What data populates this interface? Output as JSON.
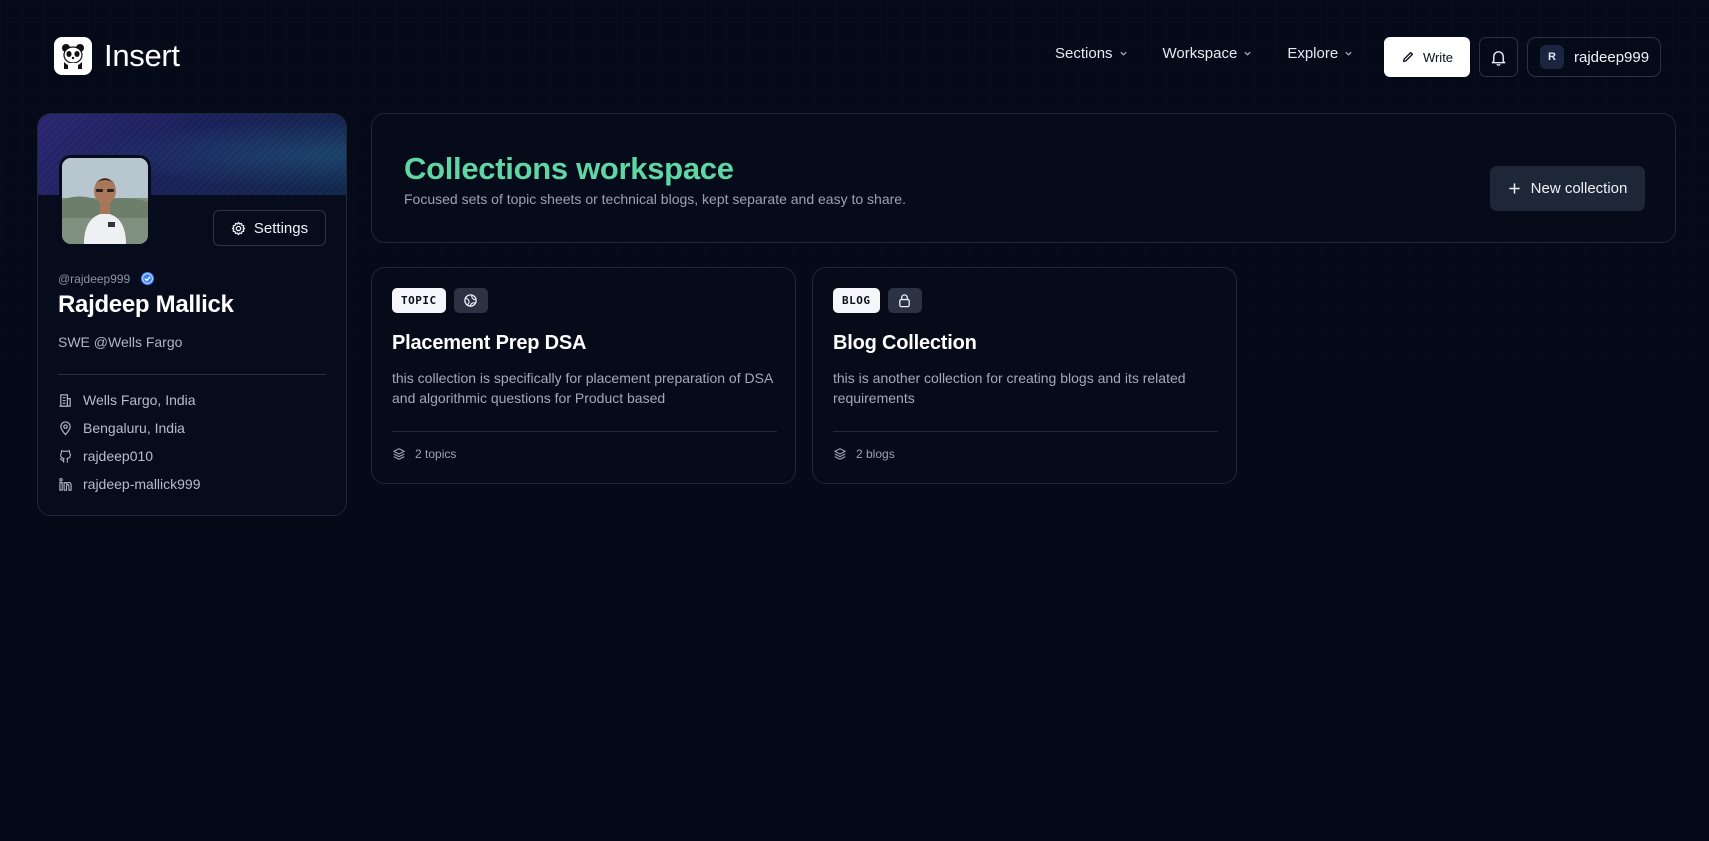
{
  "header": {
    "brand": "Insert",
    "nav": [
      {
        "label": "Sections"
      },
      {
        "label": "Workspace"
      },
      {
        "label": "Explore"
      }
    ],
    "write_label": "Write",
    "user": {
      "initial": "R",
      "username": "rajdeep999"
    }
  },
  "profile": {
    "settings_label": "Settings",
    "handle": "@rajdeep999",
    "name": "Rajdeep Mallick",
    "bio": "SWE @Wells Fargo",
    "details": [
      {
        "icon": "building-icon",
        "text": "Wells Fargo, India"
      },
      {
        "icon": "location-pin-icon",
        "text": "Bengaluru, India"
      },
      {
        "icon": "github-icon",
        "text": "rajdeep010"
      },
      {
        "icon": "linkedin-icon",
        "text": "rajdeep-mallick999"
      }
    ]
  },
  "workspace": {
    "title": "Collections workspace",
    "subtitle": "Focused sets of topic sheets or technical blogs, kept separate and easy to share.",
    "new_collection_label": "New collection"
  },
  "collections": [
    {
      "tag": "TOPIC",
      "visibility_icon": "globe-icon",
      "title": "Placement Prep DSA",
      "description": "this collection is specifically for placement preparation of DSA and algorithmic questions for Product based",
      "count_label": "2 topics"
    },
    {
      "tag": "BLOG",
      "visibility_icon": "lock-icon",
      "title": "Blog Collection",
      "description": "this is another collection for creating blogs and its related requirements",
      "count_label": "2 blogs"
    }
  ],
  "colors": {
    "background": "#050a18",
    "accent_title": "#5fd6a3",
    "card_border": "#1f2738",
    "verified_badge": "#3b82f6"
  }
}
